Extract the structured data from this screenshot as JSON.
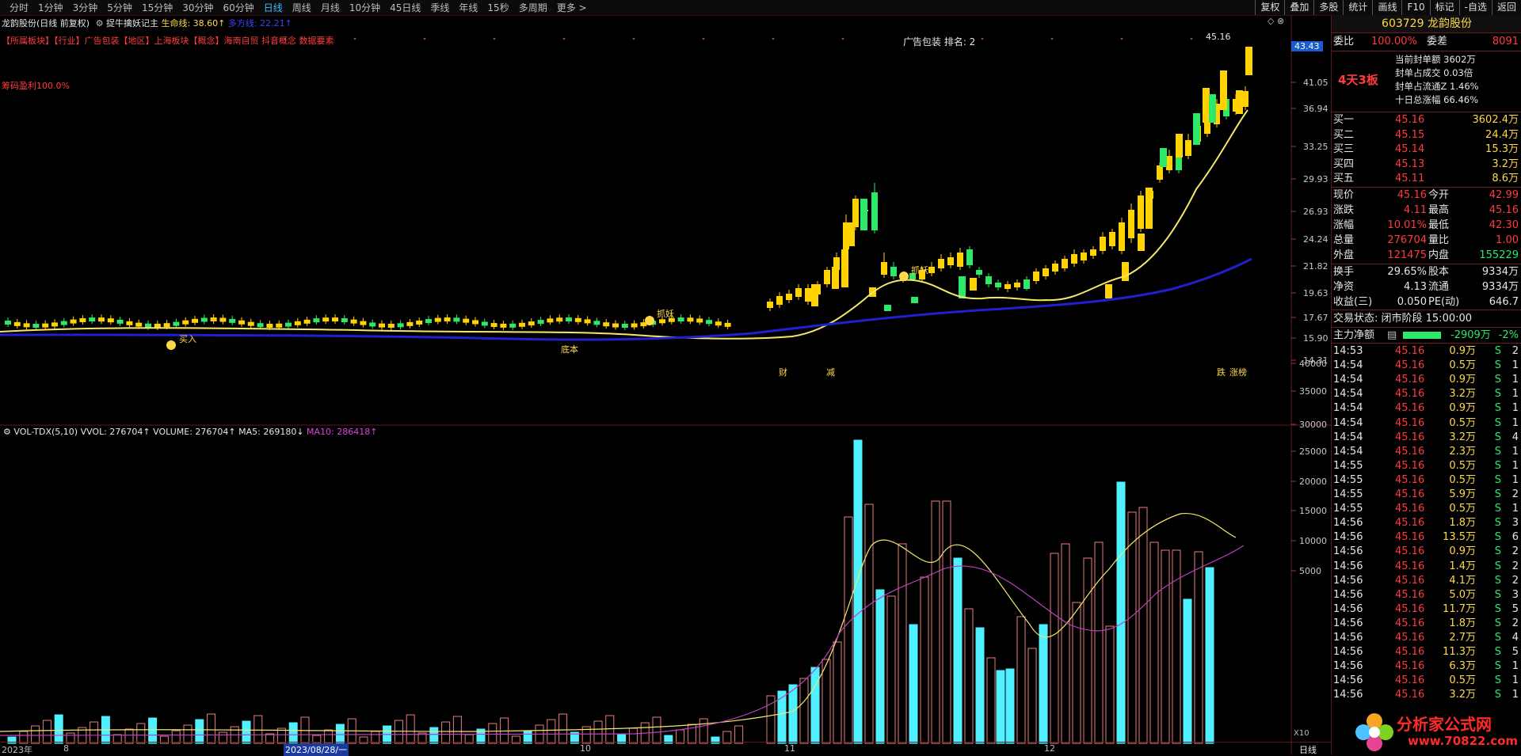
{
  "toolbar": {
    "periods": [
      "分时",
      "1分钟",
      "3分钟",
      "5分钟",
      "15分钟",
      "30分钟",
      "60分钟",
      "日线",
      "周线",
      "月线",
      "10分钟",
      "45日线",
      "季线",
      "年线",
      "15秒",
      "多周期",
      "更多 >"
    ],
    "active_period": "日线",
    "right": [
      "复权",
      "叠加",
      "多股",
      "统计",
      "画线",
      "F10",
      "标记",
      "-自选",
      "返回"
    ]
  },
  "chart": {
    "title": "龙韵股份(日线 前复权)",
    "indicator": "捉牛擒妖记主",
    "life_line_label": "生命线: 38.60↑",
    "bull_line_label": "多方线: 22.21↑",
    "tags": "【所属板块】【行业】广告包装【地区】上海板块【概念】海南自贸 抖音概念 数据要素",
    "chip_profit": "筹码盈利100.0%",
    "rank_text": "广告包装 排名: 2",
    "high_label": "45.16",
    "current_price_tag": "43.43",
    "price_ticks": [
      "41.05",
      "36.94",
      "33.25",
      "29.93",
      "26.93",
      "24.24",
      "21.82",
      "19.63",
      "17.67",
      "15.90",
      "14.31"
    ],
    "annotations": {
      "buy": "买入",
      "grab1": "抓妖",
      "grab2": "抓妖",
      "grab3": "抓妖",
      "low": "底本",
      "cai": "财",
      "jian": "减",
      "die": "跌",
      "zhangting": "涨榜"
    },
    "date_labels": [
      "2023年",
      "8",
      "2023/08/28/一",
      "10",
      "11",
      "12"
    ],
    "period_label": "日线",
    "x_mult": "X10"
  },
  "volume": {
    "header_name": "VOL-TDX(5,10)",
    "vvol": "VVOL: 276704↑",
    "volume": "VOLUME: 276704↑",
    "ma5": "MA5: 269180↓",
    "ma10": "MA10: 286418↑",
    "ticks": [
      "40000",
      "35000",
      "30000",
      "25000",
      "20000",
      "15000",
      "10000",
      "5000"
    ]
  },
  "quote": {
    "code": "603729",
    "name": "龙韵股份",
    "weibi_label": "委比",
    "weibi_value": "100.00%",
    "weicha_label": "委差",
    "weicha_value": "8091",
    "board": "4天3板",
    "seal_lines": [
      "当前封单额 3602万",
      "封单占成交 0.03倍",
      "封单占流通Z 1.46%",
      "十日总涨幅 66.46%"
    ],
    "bids": [
      {
        "label": "买一",
        "price": "45.16",
        "vol": "3602.4万"
      },
      {
        "label": "买二",
        "price": "45.15",
        "vol": "24.4万"
      },
      {
        "label": "买三",
        "price": "45.14",
        "vol": "15.3万"
      },
      {
        "label": "买四",
        "price": "45.13",
        "vol": "3.2万"
      },
      {
        "label": "买五",
        "price": "45.11",
        "vol": "8.6万"
      }
    ],
    "stats": [
      {
        "l1": "现价",
        "v1": "45.16",
        "l2": "今开",
        "v2": "42.99"
      },
      {
        "l1": "涨跌",
        "v1": "4.11",
        "l2": "最高",
        "v2": "45.16"
      },
      {
        "l1": "涨幅",
        "v1": "10.01%",
        "l2": "最低",
        "v2": "42.30"
      },
      {
        "l1": "总量",
        "v1": "276704",
        "l2": "量比",
        "v2": "1.00"
      },
      {
        "l1": "外盘",
        "v1": "121475",
        "l2": "内盘",
        "v2": "155229"
      }
    ],
    "stats2": [
      {
        "l1": "换手",
        "v1": "29.65%",
        "l2": "股本",
        "v2": "9334万"
      },
      {
        "l1": "净资",
        "v1": "4.13",
        "l2": "流通",
        "v2": "9334万"
      },
      {
        "l1": "收益(三)",
        "v1": "0.050",
        "l2": "PE(动)",
        "v2": "646.7"
      }
    ],
    "trade_status": "交易状态: 闭市阶段 15:00:00",
    "main_net_label": "主力净额",
    "main_net_value": "-2909万",
    "main_net_pct": "-2%",
    "ticks": [
      {
        "t": "14:53",
        "p": "45.16",
        "v": "0.9万",
        "s": "S",
        "n": "2"
      },
      {
        "t": "14:54",
        "p": "45.16",
        "v": "0.5万",
        "s": "S",
        "n": "1"
      },
      {
        "t": "14:54",
        "p": "45.16",
        "v": "0.9万",
        "s": "S",
        "n": "1"
      },
      {
        "t": "14:54",
        "p": "45.16",
        "v": "3.2万",
        "s": "S",
        "n": "1"
      },
      {
        "t": "14:54",
        "p": "45.16",
        "v": "0.9万",
        "s": "S",
        "n": "1"
      },
      {
        "t": "14:54",
        "p": "45.16",
        "v": "0.5万",
        "s": "S",
        "n": "1"
      },
      {
        "t": "14:54",
        "p": "45.16",
        "v": "3.2万",
        "s": "S",
        "n": "4"
      },
      {
        "t": "14:54",
        "p": "45.16",
        "v": "2.3万",
        "s": "S",
        "n": "1"
      },
      {
        "t": "14:55",
        "p": "45.16",
        "v": "0.5万",
        "s": "S",
        "n": "1"
      },
      {
        "t": "14:55",
        "p": "45.16",
        "v": "0.5万",
        "s": "S",
        "n": "1"
      },
      {
        "t": "14:55",
        "p": "45.16",
        "v": "5.9万",
        "s": "S",
        "n": "2"
      },
      {
        "t": "14:55",
        "p": "45.16",
        "v": "0.5万",
        "s": "S",
        "n": "1"
      },
      {
        "t": "14:56",
        "p": "45.16",
        "v": "1.8万",
        "s": "S",
        "n": "3"
      },
      {
        "t": "14:56",
        "p": "45.16",
        "v": "13.5万",
        "s": "S",
        "n": "6"
      },
      {
        "t": "14:56",
        "p": "45.16",
        "v": "0.9万",
        "s": "S",
        "n": "2"
      },
      {
        "t": "14:56",
        "p": "45.16",
        "v": "1.4万",
        "s": "S",
        "n": "2"
      },
      {
        "t": "14:56",
        "p": "45.16",
        "v": "4.1万",
        "s": "S",
        "n": "2"
      },
      {
        "t": "14:56",
        "p": "45.16",
        "v": "5.0万",
        "s": "S",
        "n": "3"
      },
      {
        "t": "14:56",
        "p": "45.16",
        "v": "11.7万",
        "s": "S",
        "n": "5"
      },
      {
        "t": "14:56",
        "p": "45.16",
        "v": "1.8万",
        "s": "S",
        "n": "2"
      },
      {
        "t": "14:56",
        "p": "45.16",
        "v": "2.7万",
        "s": "S",
        "n": "4"
      },
      {
        "t": "14:56",
        "p": "45.16",
        "v": "11.3万",
        "s": "S",
        "n": "5"
      },
      {
        "t": "14:56",
        "p": "45.16",
        "v": "6.3万",
        "s": "S",
        "n": "1"
      },
      {
        "t": "14:56",
        "p": "45.16",
        "v": "0.5万",
        "s": "S",
        "n": "1"
      },
      {
        "t": "14:56",
        "p": "45.16",
        "v": "3.2万",
        "s": "S",
        "n": "1"
      }
    ],
    "logo_text": "分析家公式网",
    "logo_url_text": "www.70822.com"
  },
  "colors": {
    "up": "#ffd200",
    "down": "#2ee86a",
    "vol_up": "#e8807a",
    "vol_down": "#4ff0ff",
    "ma_yellow": "#f5e76a",
    "ma_blue": "#2020d0",
    "ma10": "#c040c0"
  }
}
